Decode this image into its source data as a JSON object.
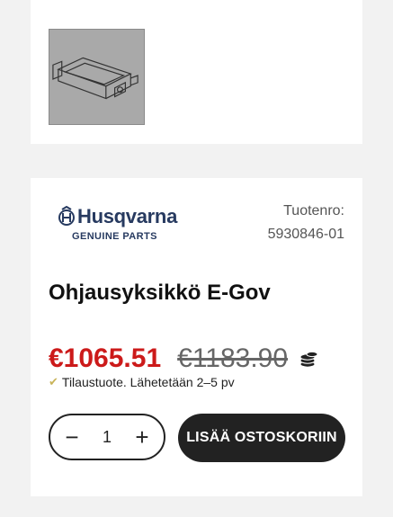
{
  "brand": {
    "name": "Husqvarna",
    "subtitle": "GENUINE PARTS",
    "color": "#273a60"
  },
  "product": {
    "sku_label": "Tuotenro:",
    "sku": "5930846-01",
    "title": "Ohjausyksikkö E-Gov",
    "price_current": "€1065.51",
    "price_original": "€1183.90",
    "availability": "Tilaustuote. Lähetetään 2–5 pv",
    "price_color": "#cc1a1a"
  },
  "cart": {
    "quantity": "1",
    "decrement_icon": "minus-icon",
    "increment_icon": "plus-icon",
    "add_label": "LISÄÄ OSTOSKORIIN"
  },
  "icons": {
    "coins": "coins-icon",
    "check": "check-icon"
  }
}
